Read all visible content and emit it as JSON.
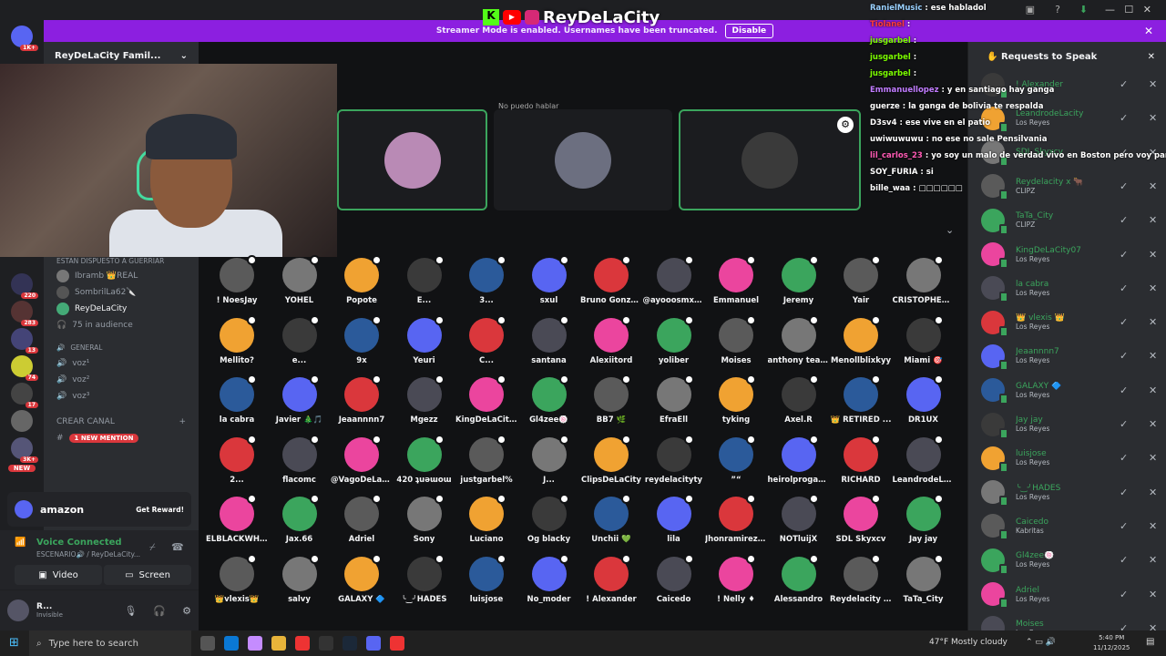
{
  "overlay": {
    "brand": "ReyDeLaCity"
  },
  "banner": {
    "text": "Streamer Mode is enabled. Usernames have been truncated.",
    "disable": "Disable"
  },
  "guilds": {
    "badges": [
      "1K+",
      "220",
      "283",
      "13",
      "74",
      "17",
      "3K+"
    ],
    "new_label": "NEW"
  },
  "sidebar": {
    "server_name": "ReyDeLaCity Famil...",
    "stage_topic": "ESTAN DISPUESTO A GUERRIAR",
    "speakers": [
      "Ibramb 👑REAL",
      "SombrilLa62🔪",
      "ReyDeLaCity"
    ],
    "audience": "75 in audience",
    "category_general": "GENERAL",
    "voice_channels": [
      "voz¹",
      "voz²",
      "voz³"
    ],
    "create_channel": "CREAR CANAL",
    "mention_badge": "1 NEW MENTION",
    "amazon": {
      "brand": "amazon",
      "cta": "Get Reward!"
    },
    "voice": {
      "status": "Voice Connected",
      "channel": "ESCENARIO🔊 / ReyDeLaCity...",
      "video": "Video",
      "screen": "Screen"
    },
    "user": {
      "name": "R...",
      "status": "Invisible"
    }
  },
  "stage": {
    "tile_caption": "No puedo hablar"
  },
  "audience": [
    "! NoesJay",
    "YOHEL",
    "Popote",
    "E...",
    "3...",
    "sxul",
    "Bruno Gonzalez",
    "@ayooosmxrl...",
    "Emmanuel",
    "Jeremy",
    "Yair",
    "CRISTOPHER LLC...",
    "Mellito?",
    "e...",
    "9x",
    "Yeuri",
    "C...",
    "santana",
    "Alexiitord",
    "yoliber",
    "Moises",
    "anthony team...",
    "Menollblixkyy",
    "Miami 🎯",
    "la cabra",
    "Javier 🎄🎵",
    "Jeaannnn7",
    "Mgezz",
    "KingDeLaCity...",
    "Gl4zee🍥",
    "BB7 🌿",
    "EfraEll",
    "tyking",
    "Axel.R",
    "👑 RETIRED ...",
    "DR1UX",
    "2...",
    "flacomc",
    "@VagoDeLaC...",
    "420 ʇuǝɯoɯ",
    "justgarbel%",
    "J...",
    "ClipsDeLaCity",
    "reydelacityty",
    "”“",
    "heirolprogamer",
    "RICHARD",
    "LeandrodeLa...",
    "ELBLACKWHI...",
    "Jax.66",
    "Adriel",
    "Sony",
    "Luciano",
    "Og blacky",
    "Unchii 💚",
    "lila",
    "Jhonramirez9...",
    "NOTluijX",
    "SDL Skyxcv",
    "Jay jay",
    "👑vlexis👑",
    "salvy",
    "GALAXY 🔷",
    "╰‿╯HADES",
    "luisjose",
    "No_moder",
    "! Alexander",
    "Caicedo",
    "! Nelly ♦",
    "Alessandro",
    "Reydelacity x...",
    "TaTa_City"
  ],
  "requests": {
    "title": "Requests to Speak",
    "items": [
      {
        "name": "! Alexander",
        "sub": ""
      },
      {
        "name": "LeandrodeLacity",
        "sub": "Los Reyes"
      },
      {
        "name": "SDL Skyxcv",
        "sub": ""
      },
      {
        "name": "Reydelacity x 🐂",
        "sub": "CLIPZ"
      },
      {
        "name": "TaTa_City",
        "sub": "CLIPZ"
      },
      {
        "name": "KingDeLaCity07",
        "sub": "Los Reyes"
      },
      {
        "name": "la cabra",
        "sub": "Los Reyes"
      },
      {
        "name": "👑 vlexis 👑",
        "sub": "Los Reyes"
      },
      {
        "name": "Jeaannnn7",
        "sub": "Los Reyes"
      },
      {
        "name": "GALAXY 🔷",
        "sub": "Los Reyes"
      },
      {
        "name": "Jay jay",
        "sub": "Los Reyes"
      },
      {
        "name": "luisjose",
        "sub": "Los Reyes"
      },
      {
        "name": "╰‿╯HADES",
        "sub": "Los Reyes"
      },
      {
        "name": "Caicedo",
        "sub": "Kabritas"
      },
      {
        "name": "Gl4zee🍥",
        "sub": "Los Reyes"
      },
      {
        "name": "Adriel",
        "sub": "Los Reyes"
      },
      {
        "name": "Moises",
        "sub": "Los Reyes"
      }
    ]
  },
  "chat": [
    {
      "user": "RanielMusic",
      "msg": "ese habladol",
      "color": "#9ad1ff"
    },
    {
      "user": "Tiolanel",
      "msg": "",
      "color": "#ff3b3b"
    },
    {
      "user": "jusgarbel",
      "msg": "",
      "color": "#7cfc00"
    },
    {
      "user": "jusgarbel",
      "msg": "",
      "color": "#7cfc00"
    },
    {
      "user": "jusgarbel",
      "msg": "",
      "color": "#7cfc00"
    },
    {
      "user": "Emmanuellopez",
      "msg": "y en santiago hay ganga",
      "color": "#c07cff"
    },
    {
      "user": "guerze",
      "msg": "la ganga de bolivia te respalda",
      "color": "#ffffff"
    },
    {
      "user": "D3sv4",
      "msg": "ese vive en el patio",
      "color": "#ffffff"
    },
    {
      "user": "uwiwuwuwu",
      "msg": "no ese no sale Pensilvania",
      "color": "#ffffff"
    },
    {
      "user": "lil_carlos_23",
      "msg": "yo soy un malo de verdad vivo en Boston pero voy para ya e",
      "color": "#ff5ab4"
    },
    {
      "user": "SOY_FURIA",
      "msg": "si",
      "color": "#ffffff"
    },
    {
      "user": "bille_waa",
      "msg": "□□□□□□",
      "color": "#ffffff"
    }
  ],
  "taskbar": {
    "search": "Type here to search",
    "weather": "47°F  Mostly cloudy",
    "time": "5:40 PM",
    "date": "11/12/2025"
  },
  "colors": {
    "accent": "#5865f2",
    "streamer": "#8c1fe0",
    "green": "#3ba55d",
    "red": "#da373c"
  }
}
